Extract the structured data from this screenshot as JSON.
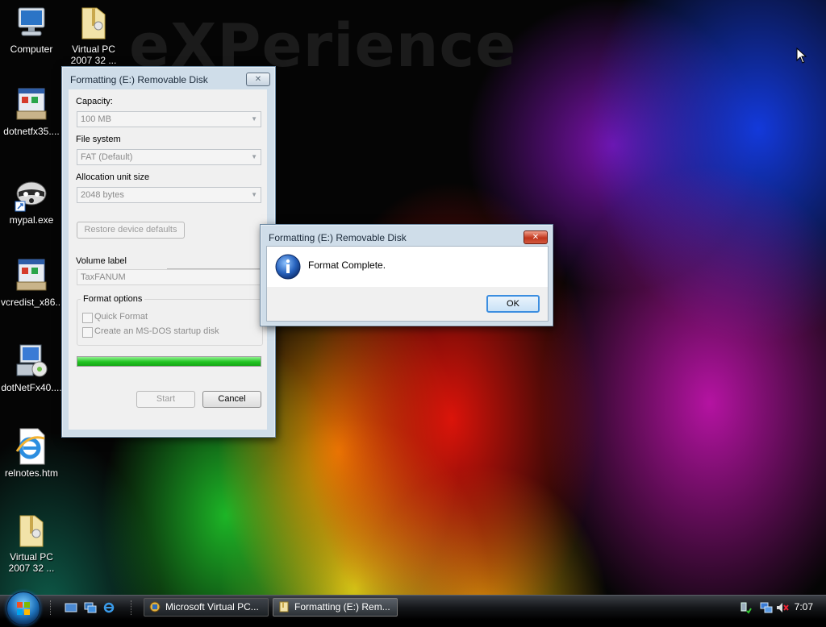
{
  "desktop": {
    "wallpaper_text": "eXPerience",
    "icons": [
      {
        "label": "Computer"
      },
      {
        "label": "Virtual PC 2007 32 ..."
      },
      {
        "label": "dotnetfx35...."
      },
      {
        "label": "mypal.exe"
      },
      {
        "label": "vcredist_x86...."
      },
      {
        "label": "dotNetFx40...."
      },
      {
        "label": "relnotes.htm"
      },
      {
        "label": "Virtual PC 2007 32 ..."
      }
    ]
  },
  "format_dialog": {
    "title": "Formatting (E:) Removable Disk",
    "capacity_label": "Capacity:",
    "capacity_value": "100 MB",
    "filesystem_label": "File system",
    "filesystem_value": "FAT (Default)",
    "allocation_label": "Allocation unit size",
    "allocation_value": "2048 bytes",
    "restore_defaults_label": "Restore device defaults",
    "volume_label_label": "Volume label",
    "volume_label_value": "TaxFANUM",
    "format_options_label": "Format options",
    "quick_format_label": "Quick Format",
    "msdos_label": "Create an MS-DOS startup disk",
    "progress_percent": 100,
    "start_label": "Start",
    "cancel_label": "Cancel"
  },
  "message_box": {
    "title": "Formatting (E:) Removable Disk",
    "message": "Format Complete.",
    "ok_label": "OK"
  },
  "taskbar": {
    "buttons": [
      {
        "label": "Microsoft Virtual PC..."
      },
      {
        "label": "Formatting (E:) Rem..."
      }
    ],
    "clock": "7:07"
  },
  "colors": {
    "accent": "#2f86d6",
    "progress": "#22c422"
  }
}
